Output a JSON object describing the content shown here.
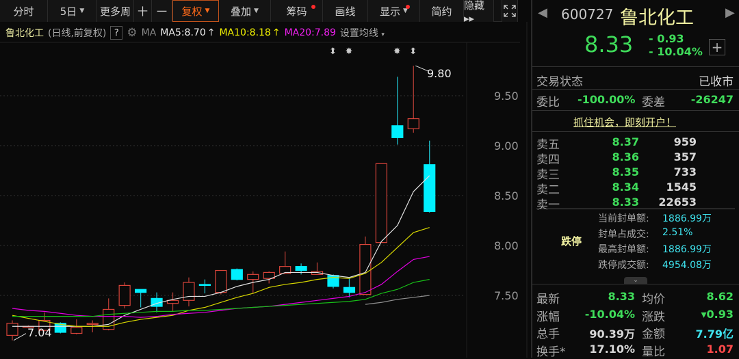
{
  "toolbar": {
    "items": [
      {
        "label": "分时",
        "w": 70
      },
      {
        "label": "5日",
        "w": 72,
        "caret": true
      },
      {
        "label": "更多周",
        "w": 54
      },
      {
        "label": "十",
        "w": 26
      },
      {
        "label": "一",
        "w": 30
      },
      {
        "label": "复权",
        "w": 68,
        "caret": true,
        "active": true
      },
      {
        "label": "叠加",
        "w": 76,
        "caret": true
      },
      {
        "label": "筹码",
        "w": 76,
        "dot": true
      },
      {
        "label": "画线",
        "w": 66
      },
      {
        "label": "显示",
        "w": 76,
        "caret": true,
        "dot": true
      },
      {
        "label": "简约",
        "w": 64
      },
      {
        "label": "隐藏 ▸▸",
        "w": 44
      }
    ],
    "fullscreen_icon": "expand-icon"
  },
  "info": {
    "name": "鲁北化工",
    "mode": "(日线,前复权)",
    "help": "?",
    "ma_label": "MA",
    "ma5": "MA5:8.70",
    "ma10": "MA10:8.18",
    "ma20": "MA20:7.89",
    "settings": "设置均线"
  },
  "colors": {
    "up": "#d9443a",
    "down": "#00f0ff",
    "ma5": "#e0e0e0",
    "ma10": "#d8d800",
    "ma20": "#e000e0",
    "ma60": "#18c018",
    "ma120": "#909090"
  },
  "chart_data": {
    "type": "candlestick",
    "yticks": [
      "9.50",
      "9.00",
      "8.50",
      "8.00",
      "7.50"
    ],
    "ytick_values": [
      9.5,
      9.0,
      8.5,
      8.0,
      7.5
    ],
    "ylim": [
      7.0,
      9.93
    ],
    "annotations": {
      "high": "9.80",
      "low": "7.04"
    },
    "markers": [
      {
        "index": 20,
        "symbol": "⬍"
      },
      {
        "index": 21,
        "symbol": "✸"
      },
      {
        "index": 24,
        "symbol": "✸"
      },
      {
        "index": 25,
        "symbol": "⬍"
      }
    ],
    "ohlc": [
      [
        7.1,
        7.25,
        7.05,
        7.22
      ],
      [
        7.19,
        7.2,
        7.18,
        7.19
      ],
      [
        7.15,
        7.33,
        7.14,
        7.25
      ],
      [
        7.22,
        7.23,
        7.12,
        7.13
      ],
      [
        7.12,
        7.26,
        7.11,
        7.18
      ],
      [
        7.21,
        7.25,
        7.13,
        7.22
      ],
      [
        7.16,
        7.47,
        7.15,
        7.36
      ],
      [
        7.4,
        7.63,
        7.37,
        7.6
      ],
      [
        7.56,
        7.56,
        7.38,
        7.53
      ],
      [
        7.47,
        7.53,
        7.33,
        7.39
      ],
      [
        7.42,
        7.53,
        7.34,
        7.45
      ],
      [
        7.45,
        7.68,
        7.39,
        7.63
      ],
      [
        7.61,
        7.66,
        7.52,
        7.6
      ],
      [
        7.53,
        7.75,
        7.51,
        7.75
      ],
      [
        7.76,
        7.77,
        7.65,
        7.66
      ],
      [
        7.66,
        7.74,
        7.52,
        7.71
      ],
      [
        7.67,
        7.74,
        7.62,
        7.73
      ],
      [
        7.72,
        7.94,
        7.72,
        7.79
      ],
      [
        7.79,
        7.82,
        7.71,
        7.75
      ],
      [
        7.71,
        7.83,
        7.71,
        7.74
      ],
      [
        7.7,
        7.71,
        7.57,
        7.59
      ],
      [
        7.58,
        7.67,
        7.48,
        7.53
      ],
      [
        7.51,
        8.09,
        7.51,
        8.01
      ],
      [
        8.03,
        8.82,
        8.03,
        8.82
      ],
      [
        9.2,
        9.69,
        9.01,
        9.08
      ],
      [
        9.17,
        9.8,
        9.13,
        9.27
      ],
      [
        8.81,
        9.05,
        8.33,
        8.34
      ]
    ],
    "series": [
      {
        "name": "MA5",
        "values": [
          7.19,
          7.19,
          7.19,
          7.19,
          7.19,
          7.19,
          7.21,
          7.3,
          7.36,
          7.42,
          7.46,
          7.49,
          7.49,
          7.53,
          7.59,
          7.63,
          7.66,
          7.73,
          7.73,
          7.73,
          7.7,
          7.68,
          7.73,
          8.04,
          8.2,
          8.54,
          8.7
        ]
      },
      {
        "name": "MA10",
        "values": [
          7.3,
          7.27,
          7.24,
          7.21,
          7.19,
          7.19,
          7.19,
          7.23,
          7.26,
          7.28,
          7.3,
          7.35,
          7.38,
          7.43,
          7.48,
          7.52,
          7.58,
          7.61,
          7.63,
          7.66,
          7.68,
          7.67,
          7.72,
          7.83,
          7.98,
          8.13,
          8.18
        ]
      },
      {
        "name": "MA20",
        "values": [
          7.37,
          7.35,
          7.34,
          7.32,
          7.3,
          7.29,
          7.29,
          7.29,
          7.28,
          7.29,
          7.31,
          7.32,
          7.33,
          7.35,
          7.37,
          7.38,
          7.39,
          7.41,
          7.43,
          7.45,
          7.47,
          7.49,
          7.53,
          7.61,
          7.74,
          7.86,
          7.89
        ]
      },
      {
        "name": "MA60",
        "values": [
          7.29,
          7.29,
          7.29,
          7.29,
          7.29,
          7.29,
          7.31,
          7.32,
          7.33,
          7.34,
          7.34,
          7.35,
          7.35,
          7.36,
          7.37,
          7.38,
          7.39,
          7.4,
          7.41,
          7.42,
          7.43,
          7.44,
          7.46,
          7.52,
          7.56,
          7.63,
          7.66
        ]
      },
      {
        "name": "MA120",
        "values": [
          null,
          null,
          null,
          null,
          null,
          null,
          null,
          null,
          null,
          null,
          null,
          null,
          null,
          null,
          null,
          null,
          null,
          null,
          null,
          null,
          null,
          null,
          7.41,
          7.43,
          7.46,
          7.48,
          7.5
        ]
      }
    ]
  },
  "quote": {
    "code": "600727",
    "name": "鲁北化工",
    "price": "8.33",
    "change": "- 0.93",
    "pct": "- 10.04%",
    "plus": "+",
    "status_label": "交易状态",
    "status": "已收市",
    "wb_label": "委比",
    "wb": "-100.00%",
    "wc_label": "委差",
    "wc": "-26247",
    "promo": "抓住机会，即刻开户！",
    "asks": [
      {
        "label": "卖五",
        "price": "8.37",
        "vol": "959"
      },
      {
        "label": "卖四",
        "price": "8.36",
        "vol": "357"
      },
      {
        "label": "卖三",
        "price": "8.35",
        "vol": "733"
      },
      {
        "label": "卖二",
        "price": "8.34",
        "vol": "1545"
      },
      {
        "label": "卖一",
        "price": "8.33",
        "vol": "22653"
      }
    ],
    "limit_label": "跌停",
    "limit_rows": [
      {
        "k": "当前封单额:",
        "v": "1886.99万"
      },
      {
        "k": "封单占成交:",
        "v": "2.51%"
      },
      {
        "k": "最高封单额:",
        "v": "1886.99万"
      },
      {
        "k": "跌停成交额:",
        "v": "4954.08万"
      }
    ],
    "stats": [
      [
        {
          "k": "最新",
          "v": "8.33",
          "c": "g"
        },
        {
          "k": "均价",
          "v": "8.62",
          "c": "g"
        }
      ],
      [
        {
          "k": "涨幅",
          "v": "-10.04%",
          "c": "g"
        },
        {
          "k": "涨跌",
          "v": "▾0.93",
          "c": "g"
        }
      ],
      [
        {
          "k": "总手",
          "v": "90.39万",
          "c": "w"
        },
        {
          "k": "金额",
          "v": "7.79亿",
          "c": "c"
        }
      ],
      [
        {
          "k": "换手*",
          "v": "17.10%",
          "c": "w"
        },
        {
          "k": "量比",
          "v": "1.07",
          "c": "r"
        }
      ]
    ]
  }
}
